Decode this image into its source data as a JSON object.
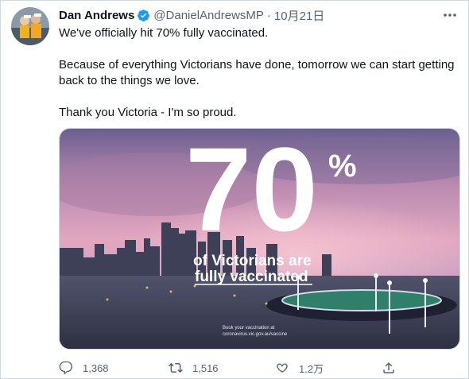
{
  "tweet": {
    "author_name": "Dan Andrews",
    "handle": "@DanielAndrewsMP",
    "separator": "·",
    "date": "10月21日",
    "text_lines": [
      "We've officially hit 70% fully vaccinated.",
      "Because of everything Victorians have done, tomorrow we can start getting back to the things we love.",
      "Thank you Victoria - I'm so proud."
    ]
  },
  "media": {
    "big_number": "70",
    "percent_sign": "%",
    "caption_line1": "of Victorians are",
    "caption_line2": "fully vaccinated",
    "small_line1": "Book your vaccination at",
    "small_line2": "coronavirus.vic.gov.au/vaccine"
  },
  "actions": {
    "reply_count": "1,368",
    "retweet_count": "1,516",
    "like_count": "1.2万"
  },
  "colors": {
    "verified": "#1d9bf0",
    "secondary_text": "#536471",
    "border": "#cfd9de"
  },
  "icons": [
    "verified-badge-icon",
    "more-icon",
    "reply-icon",
    "retweet-icon",
    "like-icon",
    "share-icon"
  ]
}
